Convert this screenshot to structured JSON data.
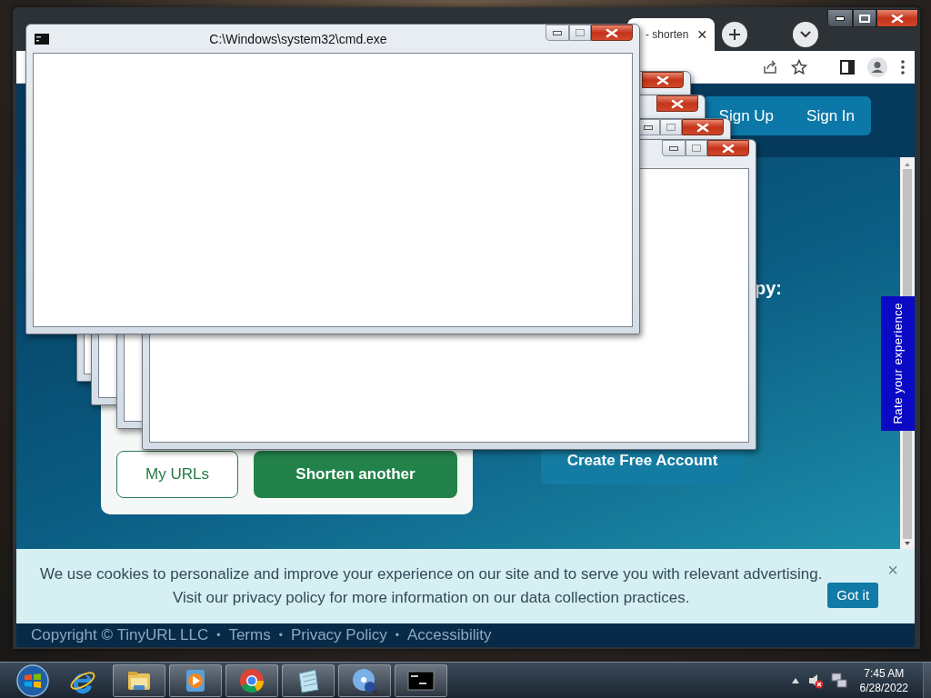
{
  "browser": {
    "tab": {
      "title": "- shorten"
    },
    "nav": [
      "Sign Up",
      "Sign In"
    ],
    "heading_fragment": "py:",
    "card_buttons": [
      {
        "label": "My URLs",
        "kind": "outline"
      },
      {
        "label": "Shorten another",
        "kind": "filled"
      }
    ],
    "cta": "Create Free Account",
    "feedback_tab": "Rate your experience",
    "cookie_banner": {
      "text": "We use cookies to personalize and improve your experience on our site and to serve you with relevant advertising. Visit our privacy policy for more information on our data collection practices.",
      "accept": "Got it",
      "close": "×"
    },
    "footer": [
      {
        "kind": "text",
        "text": "Copyright © TinyURL LLC"
      },
      {
        "kind": "sep",
        "text": "•"
      },
      {
        "kind": "link",
        "text": "Terms"
      },
      {
        "kind": "sep",
        "text": "•"
      },
      {
        "kind": "link",
        "text": "Privacy Policy"
      },
      {
        "kind": "sep",
        "text": "•"
      },
      {
        "kind": "link",
        "text": "Accessibility"
      }
    ]
  },
  "cmd_window": {
    "title": "C:\\Windows\\system32\\cmd.exe"
  },
  "taskbar": {
    "apps": [
      {
        "kind": "ie",
        "running": false
      },
      {
        "kind": "explorer",
        "running": true
      },
      {
        "kind": "media",
        "running": true
      },
      {
        "kind": "chrome",
        "running": true
      },
      {
        "kind": "notepad",
        "running": true
      },
      {
        "kind": "disc",
        "running": true
      },
      {
        "kind": "console",
        "running": true
      }
    ],
    "tray": {
      "muted": true
    },
    "clock": {
      "time": "7:45 AM",
      "date": "6/28/2022"
    }
  }
}
